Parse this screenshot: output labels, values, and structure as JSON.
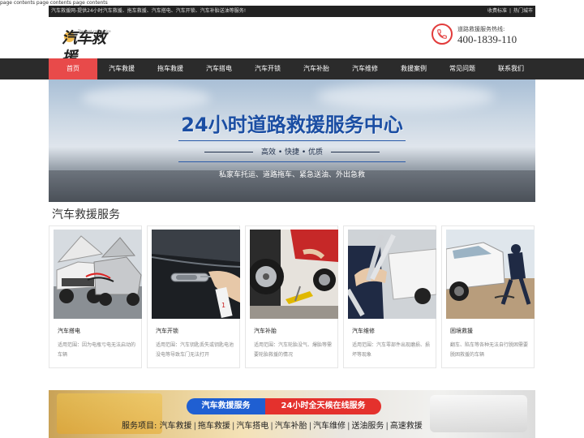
{
  "sr_text": "page contents page contents page contents",
  "topbar": {
    "slogan": "汽车救援网-提供24小时汽车救援、拖车救援、汽车搭电、汽车开锁、汽车补胎送油等服务!",
    "links": [
      "收费标准",
      "热门城市"
    ]
  },
  "logo": {
    "text": "汽车救援",
    "tagline": "The best car service"
  },
  "hotline": {
    "label": "道路救援服务热线:",
    "number": "400-1839-110"
  },
  "nav": {
    "items": [
      "首页",
      "汽车救援",
      "拖车救援",
      "汽车搭电",
      "汽车开锁",
      "汽车补胎",
      "汽车维修",
      "救援案例",
      "常见问题",
      "联系我们"
    ],
    "active_index": 0
  },
  "banner": {
    "title": "24小时道路救援服务中心",
    "subtitle": "高效 • 快捷 • 优质",
    "tagline": "私家车托运、道路拖车、紧急送油、外出急救"
  },
  "section": {
    "title": "汽车救援服务"
  },
  "cards": [
    {
      "title": "汽车搭电",
      "desc": "适用范围：因为电瓶亏电无法启动的车辆",
      "image": "jump-start-cars"
    },
    {
      "title": "汽车开锁",
      "desc": "适用范围：汽车钥匙丢失或钥匙电池没电等导致车门无法打开",
      "image": "car-door-unlock"
    },
    {
      "title": "汽车补胎",
      "desc": "适用范围：汽车轮胎没气、爆胎等需要轮胎救援的情况",
      "image": "tire-repair"
    },
    {
      "title": "汽车维修",
      "desc": "适用范围：汽车零部件出现磨损、损坏等现象",
      "image": "car-repair-wrench"
    },
    {
      "title": "困境救援",
      "desc": "翻车、陷车等各种无法自行脱困需要脱困救援的车辆",
      "image": "stuck-vehicle-rescue"
    }
  ],
  "promo": {
    "pill_a": "汽车救援服务",
    "pill_b": "24小时全天候在线服务",
    "services_label": "服务项目:",
    "services": [
      "汽车救援",
      "拖车救援",
      "汽车搭电",
      "汽车补胎",
      "汽车维修",
      "送油服务",
      "高速救援"
    ]
  },
  "colors": {
    "accent": "#e84a4a",
    "nav_bg": "#2b2b2b",
    "topbar_bg": "#222222",
    "banner_blue": "#1b4ea3",
    "pill_blue": "#1f5fd2",
    "pill_red": "#e4312d"
  }
}
